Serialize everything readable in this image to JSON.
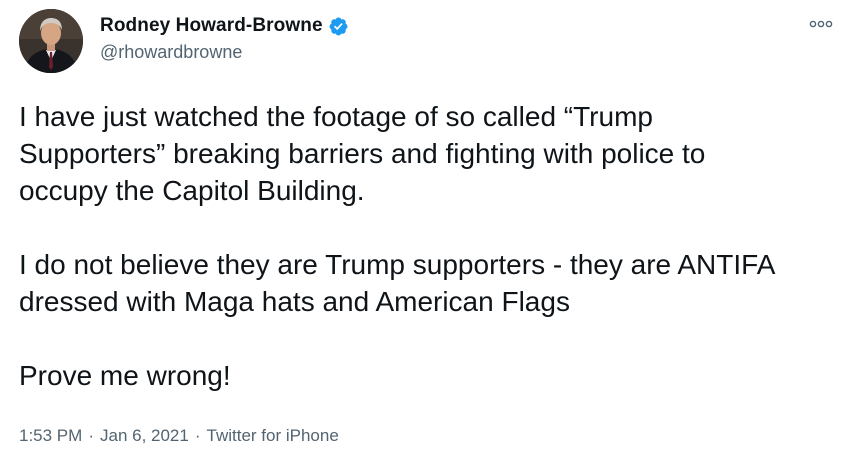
{
  "author": {
    "display_name": "Rodney Howard-Browne",
    "handle": "@rhowardbrowne",
    "verified": true
  },
  "tweet": {
    "paragraphs": [
      "I have just watched the footage of so called “Trump\nSupporters” breaking barriers and fighting with police to\noccupy the Capitol Building.",
      "I do not believe they are Trump supporters - they are ANTIFA\ndressed with Maga hats and American Flags",
      "Prove me wrong!"
    ]
  },
  "meta": {
    "time": "1:53 PM",
    "separator": "·",
    "date": "Jan 6, 2021",
    "source": "Twitter for iPhone"
  },
  "colors": {
    "verified_badge": "#1d9bf0",
    "secondary_text": "#536471",
    "primary_text": "#0f1419"
  },
  "icons": {
    "verified": "verified-badge-icon",
    "more": "more-options-icon"
  }
}
